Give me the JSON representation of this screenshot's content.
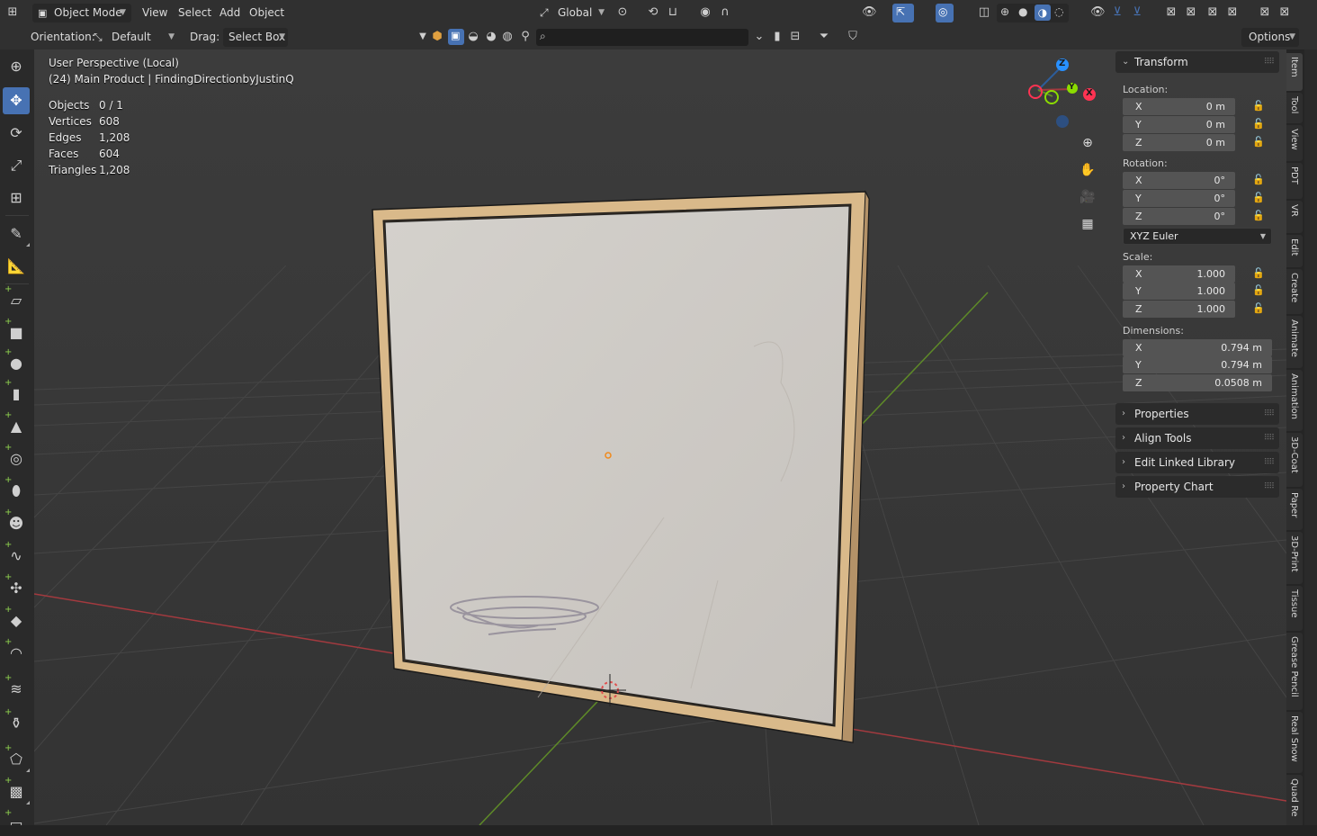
{
  "header": {
    "mode": "Object Mode",
    "menus": [
      "View",
      "Select",
      "Add",
      "Object"
    ],
    "transform_orientation": "Global",
    "options_label": "Options"
  },
  "tool_settings": {
    "orientation_label": "Orientation:",
    "orientation_value": "Default",
    "drag_label": "Drag:",
    "drag_value": "Select Box",
    "search_placeholder": ""
  },
  "viewport": {
    "view_name": "User Perspective (Local)",
    "scene_line": "(24) Main Product | FindingDirectionbyJustinQ",
    "stats": [
      {
        "label": "Objects",
        "value": "0 / 1"
      },
      {
        "label": "Vertices",
        "value": "608"
      },
      {
        "label": "Edges",
        "value": "1,208"
      },
      {
        "label": "Faces",
        "value": "604"
      },
      {
        "label": "Triangles",
        "value": "1,208"
      }
    ],
    "gizmo_axes": [
      "X",
      "Y",
      "Z"
    ]
  },
  "npanel": {
    "transform_title": "Transform",
    "location_label": "Location:",
    "location": [
      {
        "axis": "X",
        "value": "0 m"
      },
      {
        "axis": "Y",
        "value": "0 m"
      },
      {
        "axis": "Z",
        "value": "0 m"
      }
    ],
    "rotation_label": "Rotation:",
    "rotation": [
      {
        "axis": "X",
        "value": "0°"
      },
      {
        "axis": "Y",
        "value": "0°"
      },
      {
        "axis": "Z",
        "value": "0°"
      }
    ],
    "rotation_mode": "XYZ Euler",
    "scale_label": "Scale:",
    "scale": [
      {
        "axis": "X",
        "value": "1.000"
      },
      {
        "axis": "Y",
        "value": "1.000"
      },
      {
        "axis": "Z",
        "value": "1.000"
      }
    ],
    "dimensions_label": "Dimensions:",
    "dimensions": [
      {
        "axis": "X",
        "value": "0.794 m"
      },
      {
        "axis": "Y",
        "value": "0.794 m"
      },
      {
        "axis": "Z",
        "value": "0.0508 m"
      }
    ],
    "panels": [
      "Properties",
      "Align Tools",
      "Edit Linked Library",
      "Property Chart"
    ]
  },
  "tabs": [
    "Item",
    "Tool",
    "View",
    "PDT",
    "VR",
    "Edit",
    "Create",
    "Animate",
    "Animation",
    "3D-Coat",
    "Paper",
    "3D-Print",
    "Tissue",
    "Grease Pencil",
    "Real Snow",
    "Quad Re"
  ],
  "colors": {
    "accent": "#4772b3",
    "x_axis": "#ff3352",
    "y_axis": "#8bdc00",
    "z_axis": "#2890ff",
    "frame_wood": "#d9b98a"
  }
}
